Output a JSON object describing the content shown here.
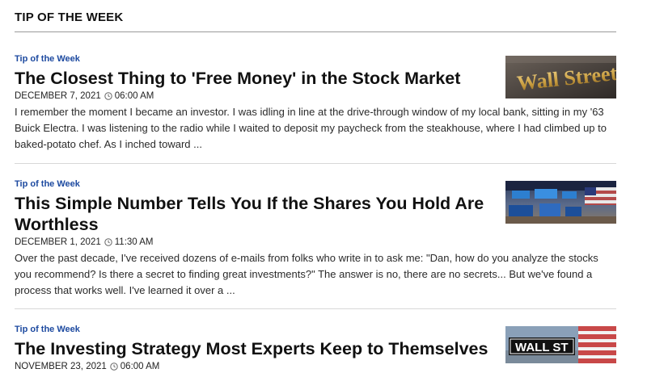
{
  "section": {
    "title": "TIP OF THE WEEK"
  },
  "articles": [
    {
      "category": "Tip of the Week",
      "title": "The Closest Thing to 'Free Money' in the Stock Market",
      "date": "DECEMBER 7, 2021",
      "time": "06:00 AM",
      "excerpt": "I remember the moment I became an investor. I was idling in line at the drive-through window of my local bank, sitting in my '63 Buick Electra. I was listening to the radio while I waited to deposit my paycheck from the steakhouse, where I had climbed up to baked-potato chef. As I inched toward ..."
    },
    {
      "category": "Tip of the Week",
      "title": "This Simple Number Tells You If the Shares You Hold Are Worthless",
      "date": "DECEMBER 1, 2021",
      "time": "11:30 AM",
      "excerpt": "Over the past decade, I've received dozens of e-mails from folks who write in to ask me: \"Dan, how do you analyze the stocks you recommend? Is there a secret to finding great investments?\" The answer is no, there are no secrets... But we've found a process that works well. I've learned it over a ..."
    },
    {
      "category": "Tip of the Week",
      "title": "The Investing Strategy Most Experts Keep to Themselves",
      "date": "NOVEMBER 23, 2021",
      "time": "06:00 AM",
      "excerpt": ""
    }
  ],
  "images": {
    "wall_street_sign": "Wall Street",
    "street_sign": "WALL ST"
  },
  "colors": {
    "accent": "#1d4aa0",
    "divider": "#d8d8d8"
  }
}
